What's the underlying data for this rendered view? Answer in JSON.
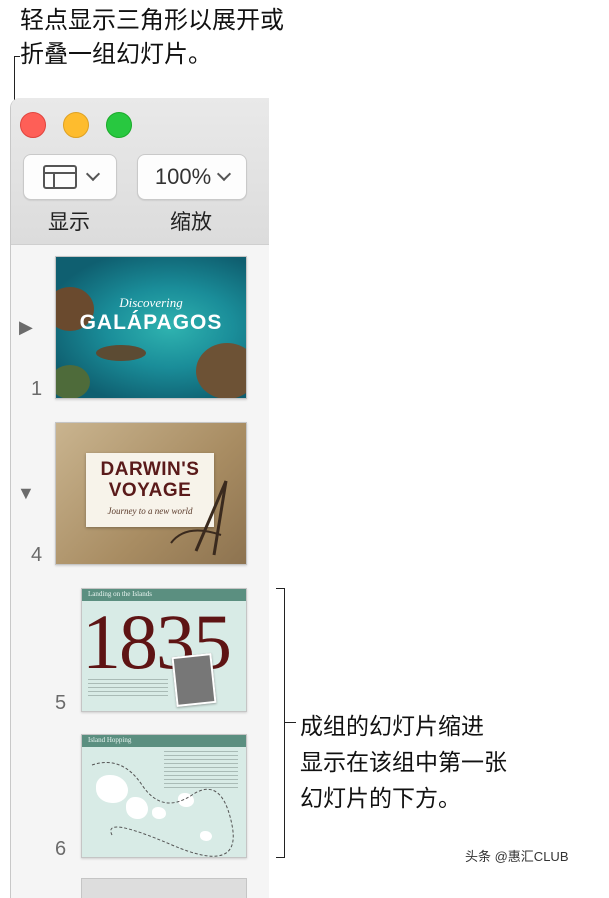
{
  "callout_top": [
    "轻点显示三角形以展开或",
    "折叠一组幻灯片。"
  ],
  "callout_right": [
    "成组的幻灯片缩进",
    "显示在该组中第一张",
    "幻灯片的下方。"
  ],
  "toolbar": {
    "view_label": "显示",
    "zoom_value": "100%",
    "zoom_label": "缩放"
  },
  "slides": [
    {
      "number": "1",
      "disclosure": "▶",
      "title_small": "Discovering",
      "title_big": "GALÁPAGOS"
    },
    {
      "number": "4",
      "disclosure": "▼",
      "title_big_1": "DARWIN'S",
      "title_big_2": "VOYAGE",
      "subtitle": "Journey to a new world"
    },
    {
      "number": "5",
      "header": "Landing on the Islands",
      "big": "1835"
    },
    {
      "number": "6",
      "header": "Island Hopping"
    }
  ],
  "watermark": "头条 @惠汇CLUB",
  "colors": {
    "traffic_red": "#fe5f57",
    "traffic_yellow": "#febc2e",
    "traffic_green": "#28c840"
  }
}
